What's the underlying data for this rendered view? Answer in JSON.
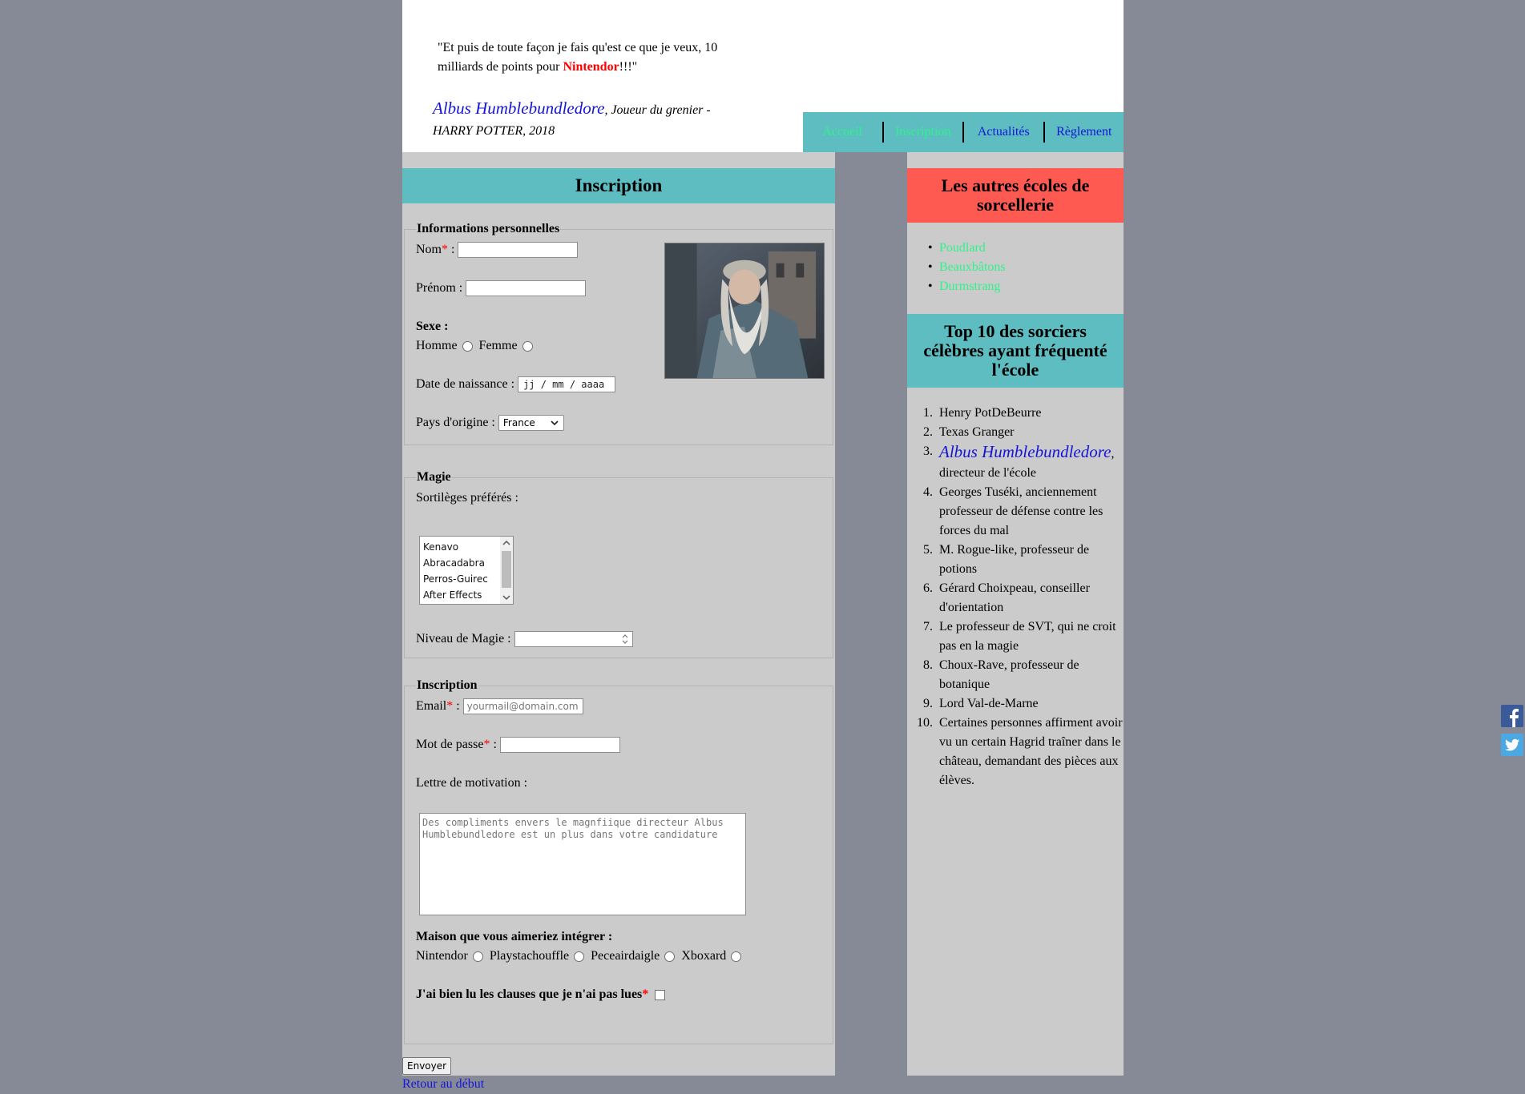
{
  "header": {
    "quote_part1": "\"Et puis de toute façon je fais qu'est ce que je veux, 10 milliards de points pour ",
    "quote_brand": "Nintendor",
    "quote_part2": "!!!\"",
    "author_name": "Albus Humblebundledore",
    "author_title": ", Joueur du grenier - HARRY POTTER, 2018"
  },
  "nav": {
    "items": [
      {
        "label": "Accueil"
      },
      {
        "label": "Inscription"
      },
      {
        "label": "Actualités"
      },
      {
        "label": "Règlement"
      }
    ]
  },
  "main": {
    "title": "Inscription",
    "personal": {
      "legend": "Informations personnelles",
      "nom_label": "Nom",
      "prenom_label": "Prénom :",
      "sexe_label": "Sexe :",
      "homme_label": "Homme",
      "femme_label": "Femme",
      "birth_label": "Date de naissance :",
      "birth_placeholder": "jj / mm / aaaa",
      "country_label": "Pays d'origine :",
      "country_value": "France"
    },
    "magie": {
      "legend": "Magie",
      "spells_label": "Sortilèges préférés :",
      "spells": [
        "Kenavo",
        "Abracadabra",
        "Perros-Guirec",
        "After Effects"
      ],
      "level_label": "Niveau de Magie :"
    },
    "inscription": {
      "legend": "Inscription",
      "email_label": "Email",
      "email_placeholder": "yourmail@domain.com",
      "password_label": "Mot de passe",
      "letter_label": "Lettre de motivation :",
      "letter_placeholder": "Des compliments envers le magnfiique directeur Albus Humblebundledore est un plus dans votre candidature",
      "house_label": "Maison que vous aimeriez intégrer :",
      "houses": [
        "Nintendor",
        "Playstachouffle",
        "Peceairdaigle",
        "Xboxard"
      ],
      "clauses_label": "J'ai bien lu les clauses que je n'ai pas lues"
    },
    "submit_label": "Envoyer",
    "back_label": "Retour au début"
  },
  "sidebar": {
    "schools_title": "Les autres écoles de sorcellerie",
    "schools": [
      "Poudlard",
      "Beauxbâtons",
      "Durmstrang"
    ],
    "top_title": "Top 10 des sorciers célèbres ayant fréquenté l'école",
    "top": [
      "Henry PotDeBeurre",
      "Texas Granger",
      "directeur de l'école",
      "Georges Tuséki, anciennement professeur de défense contre les forces du mal",
      "M. Rogue-like, professeur de potions",
      "Gérard Choixpeau, conseiller d'orientation",
      "Le professeur de SVT, qui ne croit pas en la magie",
      "Choux-Rave, professeur de botanique",
      "Lord Val-de-Marne",
      "Certaines personnes affirment avoir vu un certain Hagrid traîner dans le château, demandant des pièces aux élèves."
    ],
    "top3_name": "Albus Humblebundledore",
    "top3_sep": ","
  },
  "social": {
    "icons": [
      "facebook-icon",
      "twitter-icon"
    ]
  },
  "colors": {
    "teal": "#5dbdc0",
    "red_header": "#ff5a52",
    "link_green": "#31f28a",
    "link_blue": "#1515d8",
    "background": "#868a96",
    "panel": "#cbcbcb"
  }
}
